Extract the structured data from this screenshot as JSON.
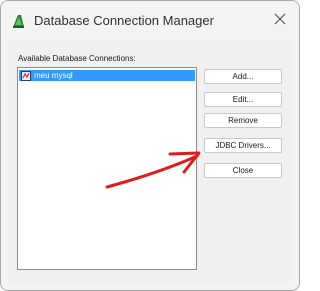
{
  "window": {
    "title": "Database Connection Manager",
    "app_icon": "app-icon",
    "close_icon": "close-icon"
  },
  "dialog": {
    "list_label": "Available Database Connections:",
    "connections": [
      {
        "name": "meu mysql",
        "selected": true,
        "icon": "database-icon"
      }
    ],
    "buttons": {
      "add": "Add...",
      "edit": "Edit...",
      "remove": "Remove",
      "jdbc": "JDBC Drivers...",
      "close": "Close"
    }
  },
  "annotation": {
    "type": "red-hand-drawn-arrow",
    "color": "#e01b1b"
  }
}
